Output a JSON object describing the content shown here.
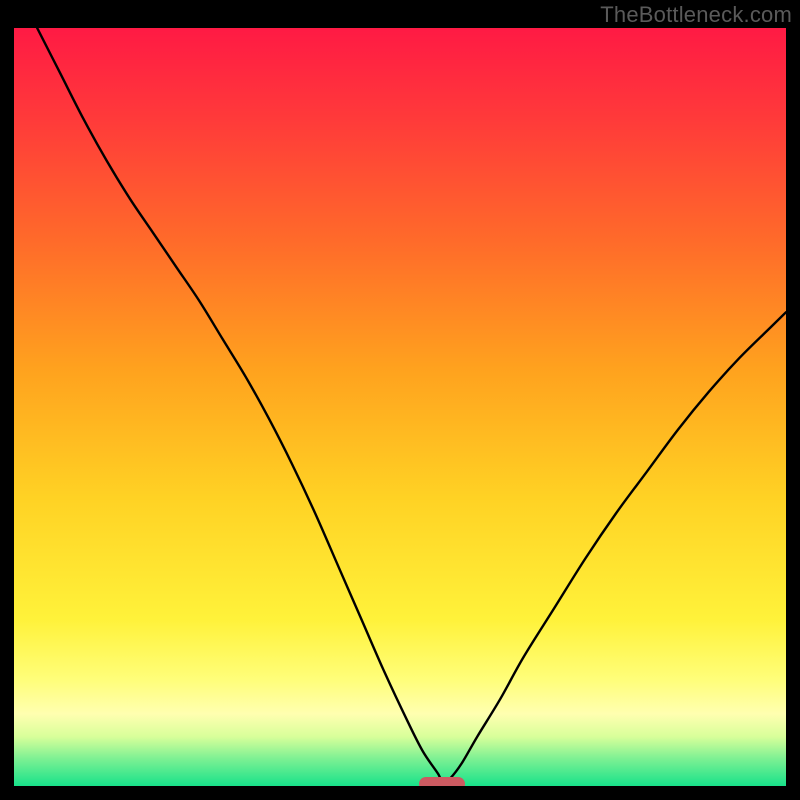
{
  "watermark": "TheBottleneck.com",
  "colors": {
    "frame": "#000000",
    "gradient_stops": [
      {
        "offset": 0.0,
        "color": "#ff1a44"
      },
      {
        "offset": 0.12,
        "color": "#ff3a3a"
      },
      {
        "offset": 0.28,
        "color": "#ff6a2a"
      },
      {
        "offset": 0.45,
        "color": "#ffa21e"
      },
      {
        "offset": 0.62,
        "color": "#ffd224"
      },
      {
        "offset": 0.78,
        "color": "#fff23a"
      },
      {
        "offset": 0.86,
        "color": "#fffe7a"
      },
      {
        "offset": 0.905,
        "color": "#ffffb0"
      },
      {
        "offset": 0.935,
        "color": "#d8ff9a"
      },
      {
        "offset": 0.965,
        "color": "#7af093"
      },
      {
        "offset": 1.0,
        "color": "#18e28a"
      }
    ],
    "curve": "#000000",
    "marker": "#cc5a61"
  },
  "chart_data": {
    "type": "line",
    "title": "",
    "xlabel": "",
    "ylabel": "",
    "xlim": [
      0,
      100
    ],
    "ylim": [
      0,
      100
    ],
    "grid": false,
    "legend": false,
    "notes": "V-shaped bottleneck curve; minimum near x≈55.5. No axis tick labels shown in image; values estimated from pixel positions.",
    "series": [
      {
        "name": "bottleneck-curve",
        "x": [
          3,
          6,
          9,
          12,
          15,
          18,
          21,
          24,
          27,
          30,
          33,
          36,
          39,
          42,
          45,
          48,
          51,
          53,
          55,
          55.5,
          56.5,
          58,
          60,
          63,
          66,
          70,
          74,
          78,
          82,
          86,
          90,
          94,
          98,
          100
        ],
        "y": [
          100,
          94,
          88,
          82.5,
          77.5,
          73,
          68.5,
          64,
          59,
          54,
          48.5,
          42.5,
          36,
          29,
          22,
          15,
          8.5,
          4.5,
          1.5,
          0.3,
          1.0,
          3.0,
          6.5,
          11.5,
          17,
          23.5,
          30,
          36,
          41.5,
          47,
          52,
          56.5,
          60.5,
          62.5
        ]
      }
    ],
    "markers": [
      {
        "name": "min-marker",
        "x": 55.5,
        "y": 0.3,
        "shape": "rounded-bar"
      }
    ]
  }
}
